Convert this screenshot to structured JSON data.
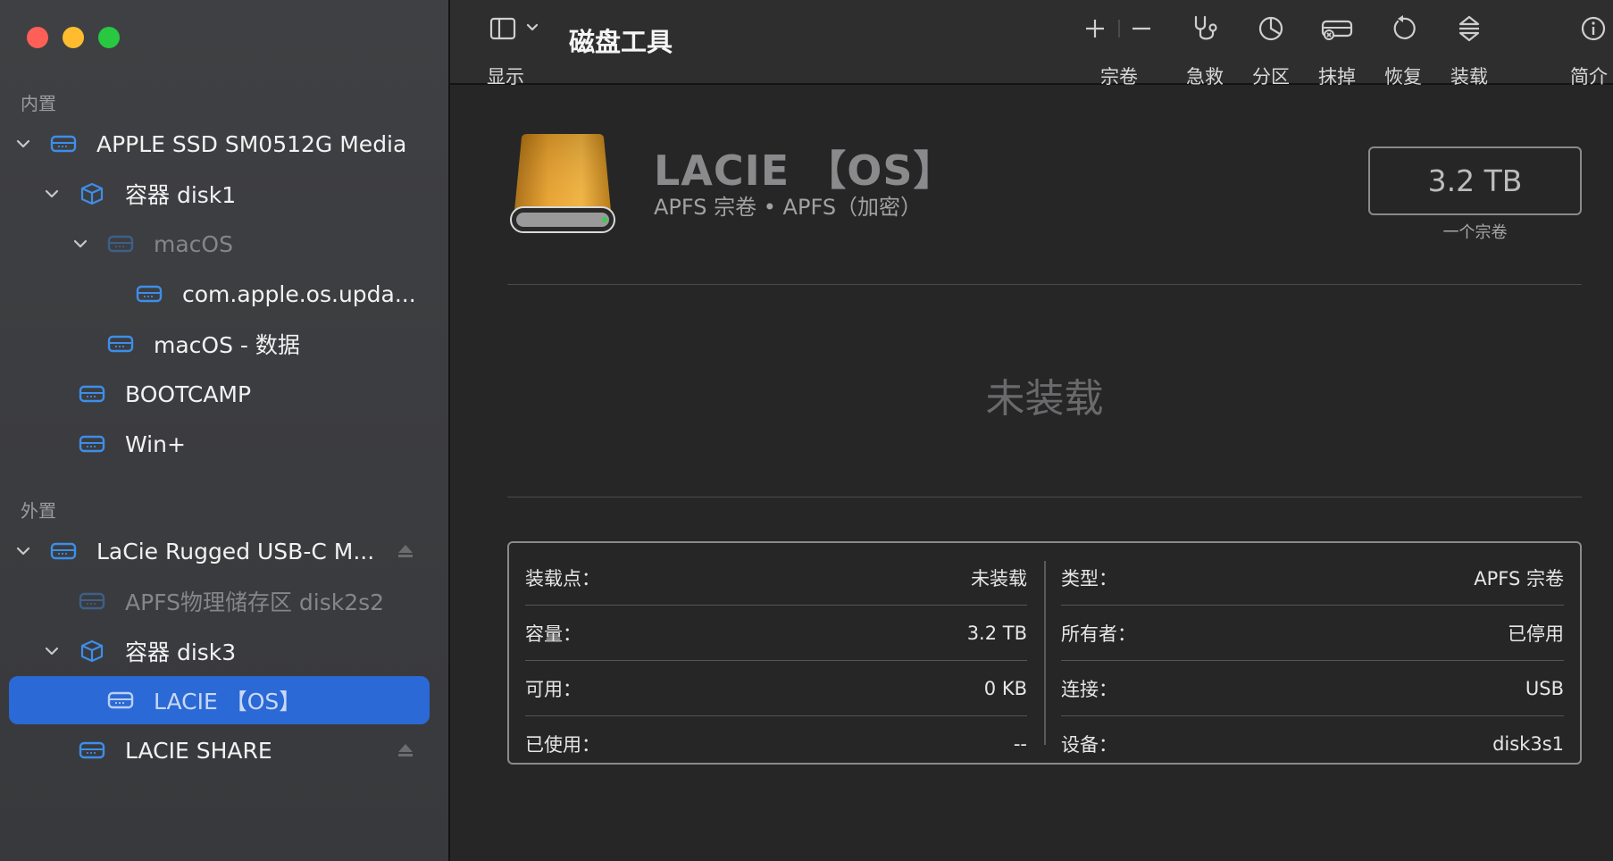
{
  "window": {
    "title": "磁盘工具"
  },
  "toolbar": {
    "view_label": "显示",
    "volume_label": "宗卷",
    "firstaid_label": "急救",
    "partition_label": "分区",
    "erase_label": "抹掉",
    "restore_label": "恢复",
    "mount_label": "装载",
    "info_label": "简介"
  },
  "sidebar": {
    "internal_label": "内置",
    "external_label": "外置",
    "items": [
      {
        "label": "APPLE SSD SM0512G Media"
      },
      {
        "label": "容器 disk1"
      },
      {
        "label": "macOS"
      },
      {
        "label": "com.apple.os.upda..."
      },
      {
        "label": "macOS - 数据"
      },
      {
        "label": "BOOTCAMP"
      },
      {
        "label": "Win+"
      },
      {
        "label": "LaCie Rugged USB-C M..."
      },
      {
        "label": "APFS物理储存区 disk2s2"
      },
      {
        "label": "容器 disk3"
      },
      {
        "label": "LACIE 【OS】"
      },
      {
        "label": "LACIE SHARE"
      }
    ]
  },
  "volume": {
    "name": "LACIE 【OS】",
    "subtitle": "APFS 宗卷 • APFS（加密）",
    "capacity": "3.2 TB",
    "capacity_caption": "一个宗卷",
    "status": "未装载"
  },
  "info": {
    "left": [
      {
        "key": "装载点：",
        "value": "未装载"
      },
      {
        "key": "容量：",
        "value": "3.2 TB"
      },
      {
        "key": "可用：",
        "value": "0 KB"
      },
      {
        "key": "已使用：",
        "value": "--"
      }
    ],
    "right": [
      {
        "key": "类型：",
        "value": "APFS 宗卷"
      },
      {
        "key": "所有者：",
        "value": "已停用"
      },
      {
        "key": "连接：",
        "value": "USB"
      },
      {
        "key": "设备：",
        "value": "disk3s1"
      }
    ]
  },
  "colors": {
    "accent": "#2b69d6",
    "sidebar_bg": "#3f4043",
    "main_bg": "#262626",
    "icon_blue": "#3d8eea",
    "close": "#fe5f57",
    "minimize": "#febc2e",
    "zoom": "#28c840"
  }
}
